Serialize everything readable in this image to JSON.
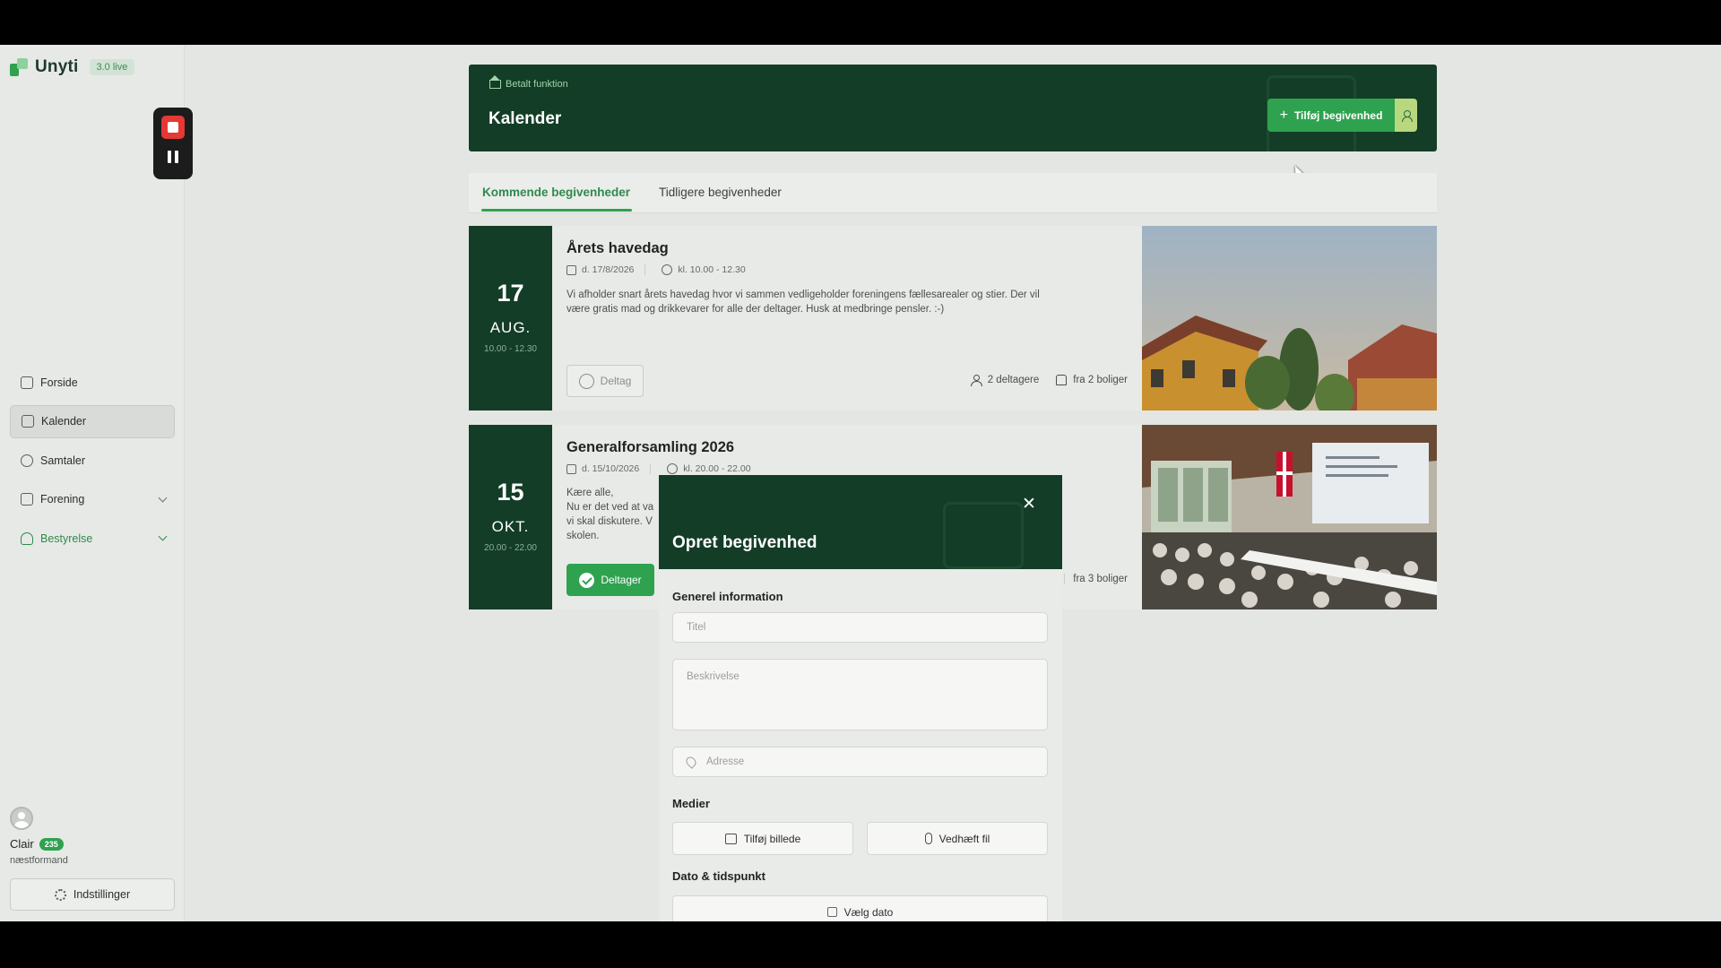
{
  "app": {
    "name": "Unyti",
    "version": "3.0 live"
  },
  "sidebar": {
    "items": [
      {
        "label": "Forside"
      },
      {
        "label": "Kalender"
      },
      {
        "label": "Samtaler"
      },
      {
        "label": "Forening"
      },
      {
        "label": "Bestyrelse"
      }
    ],
    "user": {
      "name": "Clair",
      "badge": "235",
      "role": "næstformand"
    },
    "settings_label": "Indstillinger"
  },
  "header": {
    "paid_label": "Betalt funktion",
    "title": "Kalender",
    "add_button": "Tilføj begivenhed"
  },
  "tabs": [
    {
      "label": "Kommende begivenheder",
      "active": true
    },
    {
      "label": "Tidligere begivenheder",
      "active": false
    }
  ],
  "events": [
    {
      "day": "17",
      "month": "AUG.",
      "time_range": "10.00 - 12.30",
      "title": "Årets havedag",
      "date": "d. 17/8/2026",
      "time": "kl. 10.00  -  12.30",
      "description": "Vi afholder snart årets havedag hvor vi sammen vedligeholder foreningens fællesarealer og stier. Der vil være gratis mad og drikkevarer for alle der deltager. Husk at medbringe pensler. :-)",
      "join_label": "Deltag",
      "participants": "2 deltagere",
      "homes": "fra 2 boliger"
    },
    {
      "day": "15",
      "month": "OKT.",
      "time_range": "20.00 - 22.00",
      "title": "Generalforsamling 2026",
      "date": "d. 15/10/2026",
      "time": "kl. 20.00  -  22.00",
      "description_lines": [
        "Kære alle,",
        "Nu er det ved at va",
        "vi skal diskutere. V",
        "skolen."
      ],
      "join_label": "Deltager",
      "homes": "fra 3 boliger"
    }
  ],
  "modal": {
    "title": "Opret begivenhed",
    "section_general": "Generel information",
    "title_placeholder": "Titel",
    "description_placeholder": "Beskrivelse",
    "address_placeholder": "Adresse",
    "section_media": "Medier",
    "add_image": "Tilføj billede",
    "attach_file": "Vedhæft fil",
    "section_datetime": "Dato & tidspunkt",
    "choose_date": "Vælg dato"
  },
  "colors": {
    "brand_dark": "#133d27",
    "accent": "#2ea24f"
  }
}
